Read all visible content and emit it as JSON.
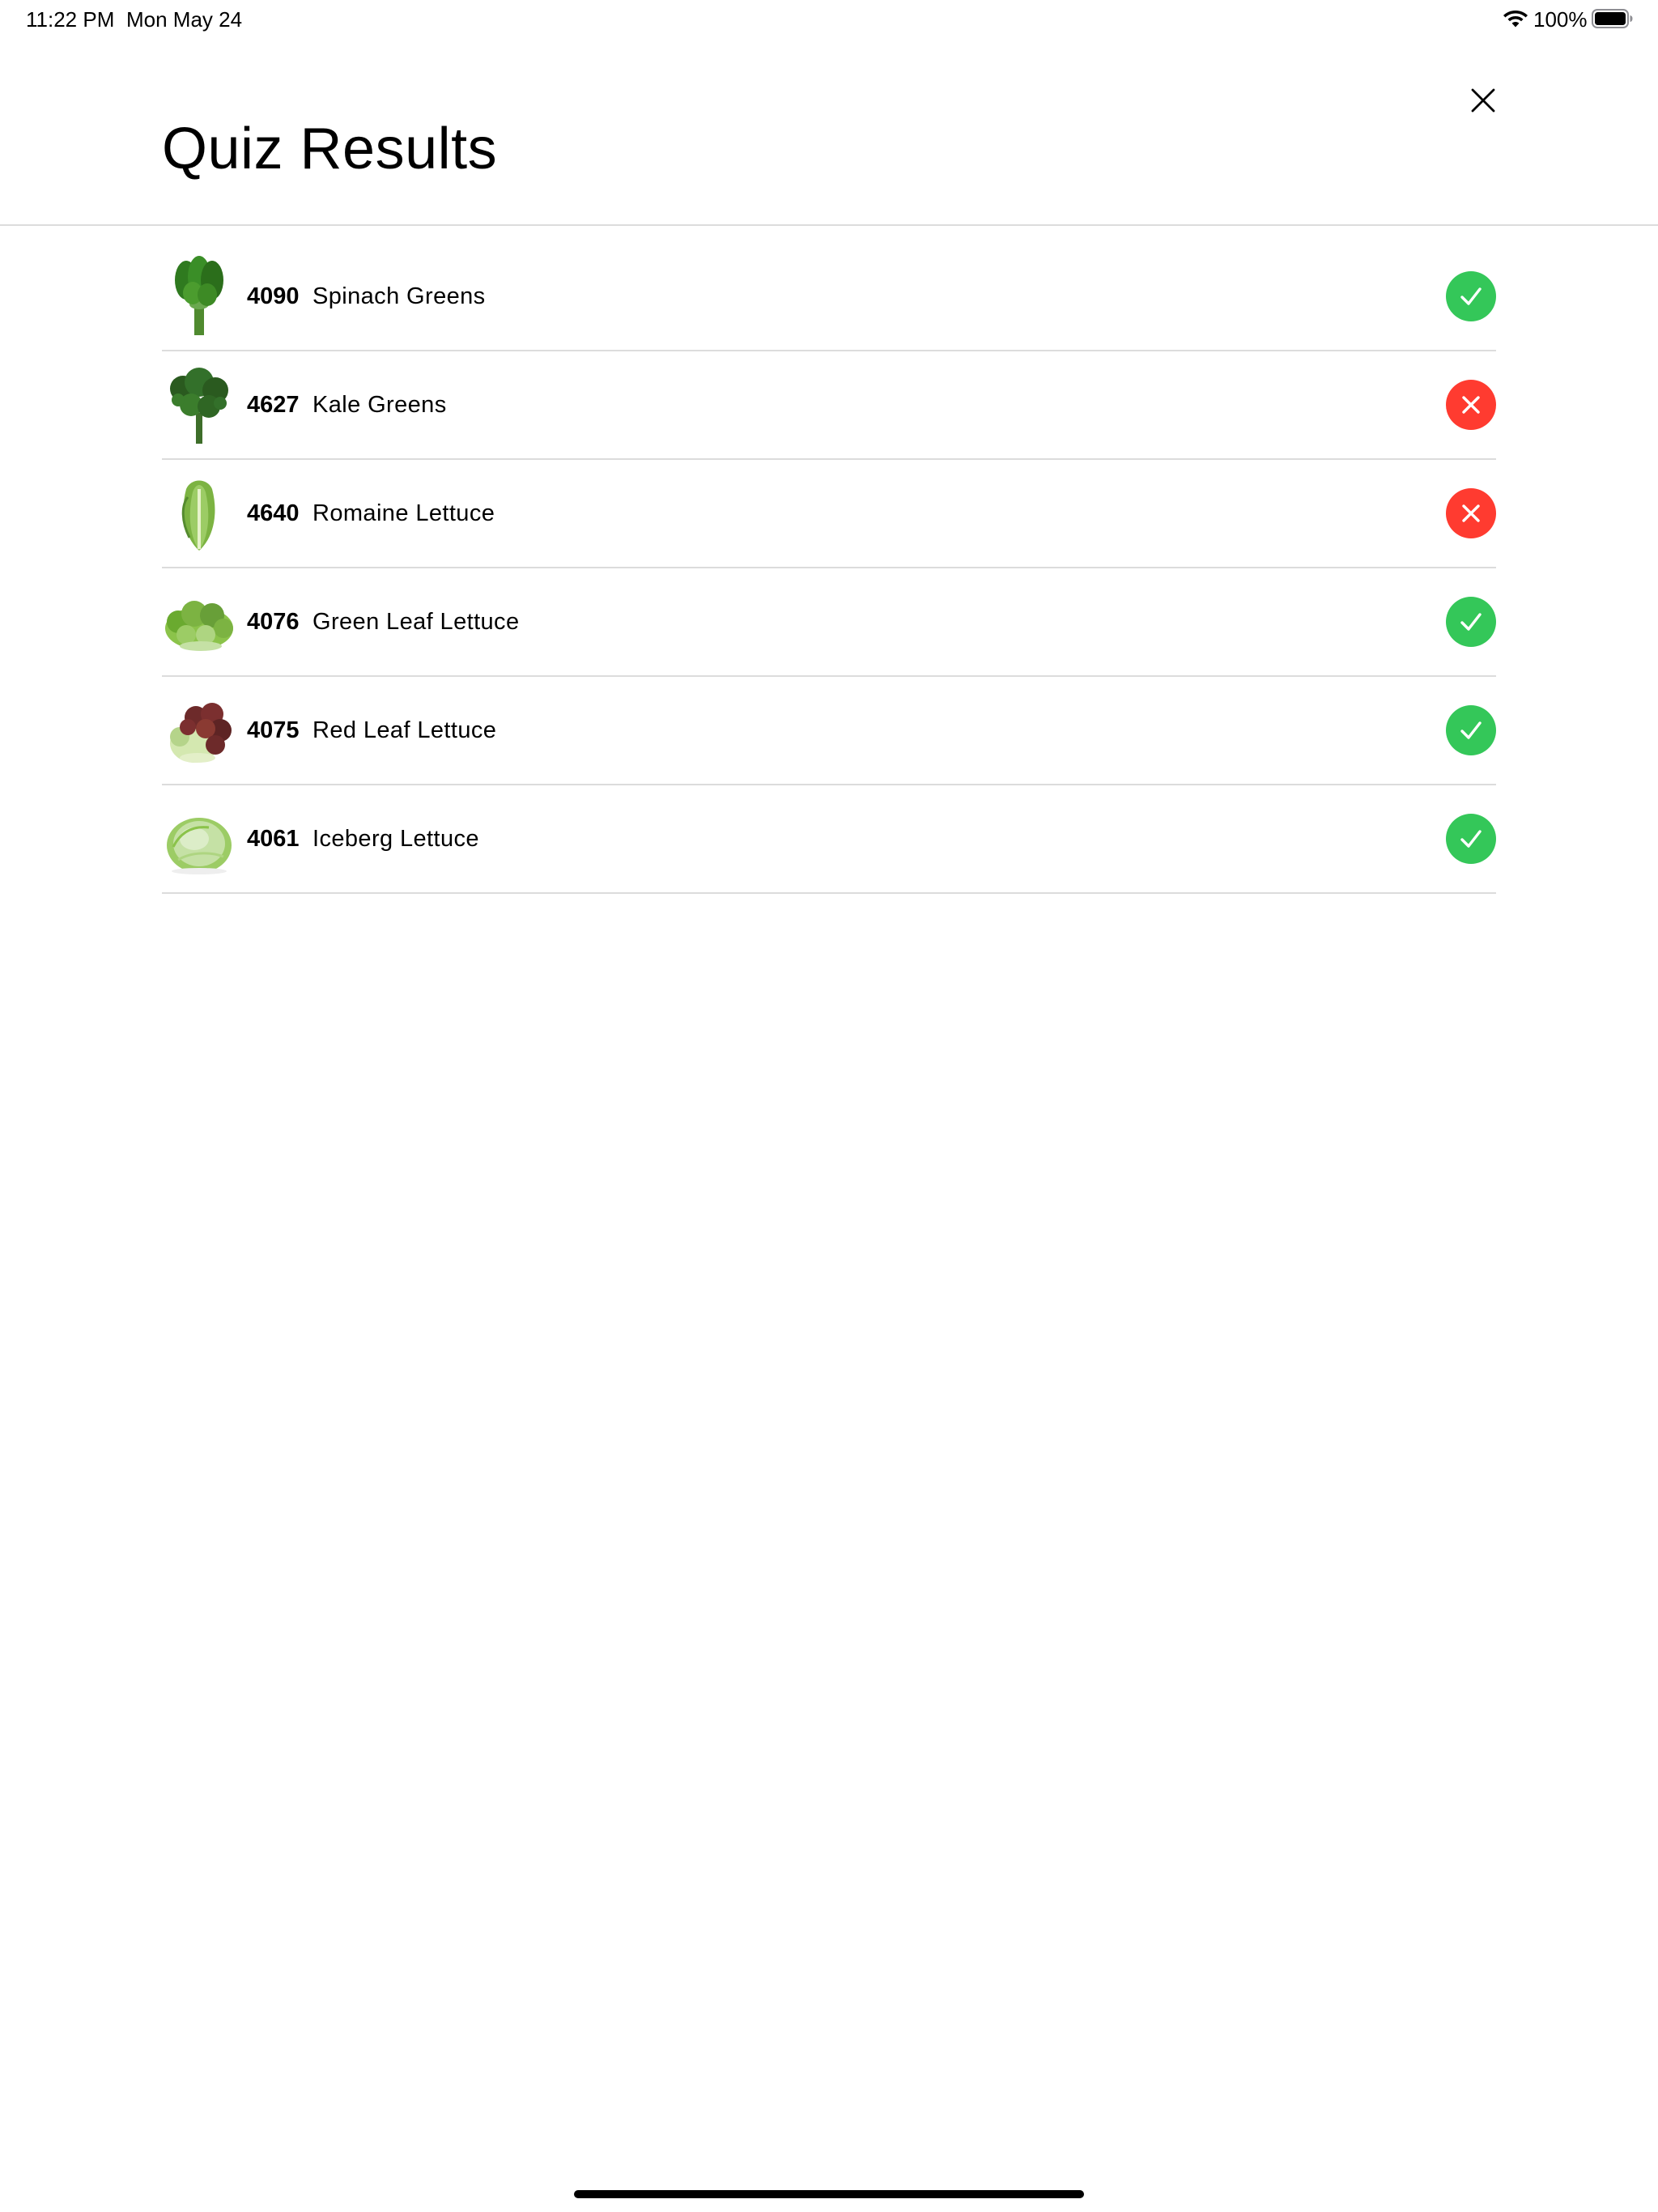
{
  "status_bar": {
    "time": "11:22 PM",
    "date": "Mon May 24",
    "battery": "100%"
  },
  "header": {
    "title": "Quiz Results",
    "close_icon": "close-icon"
  },
  "results": [
    {
      "plu": "4090",
      "name": "Spinach Greens",
      "correct": true,
      "icon": "check-icon",
      "image": "spinach-image"
    },
    {
      "plu": "4627",
      "name": "Kale Greens",
      "correct": false,
      "icon": "x-icon",
      "image": "kale-image"
    },
    {
      "plu": "4640",
      "name": "Romaine Lettuce",
      "correct": false,
      "icon": "x-icon",
      "image": "romaine-image"
    },
    {
      "plu": "4076",
      "name": "Green Leaf Lettuce",
      "correct": true,
      "icon": "check-icon",
      "image": "green-leaf-image"
    },
    {
      "plu": "4075",
      "name": "Red Leaf Lettuce",
      "correct": true,
      "icon": "check-icon",
      "image": "red-leaf-image"
    },
    {
      "plu": "4061",
      "name": "Iceberg Lettuce",
      "correct": true,
      "icon": "check-icon",
      "image": "iceberg-image"
    }
  ],
  "colors": {
    "correct": "#34c759",
    "incorrect": "#ff3b30",
    "divider": "#dcdcdc"
  }
}
